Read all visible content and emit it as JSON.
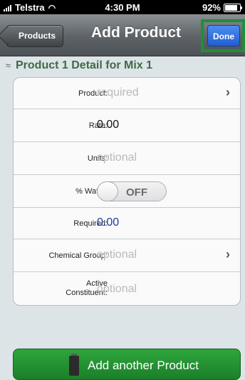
{
  "status_bar": {
    "carrier": "Telstra",
    "time": "4:30 PM",
    "battery_percent": "92%",
    "battery_level": 0.92
  },
  "nav": {
    "back_label": "Products",
    "title": "Add Product",
    "done_label": "Done",
    "done_highlight_color": "#1f8f3a"
  },
  "section": {
    "title": "Product 1 Detail for Mix 1",
    "collapse_icon": "collapse-up-icon"
  },
  "form": {
    "product": {
      "label": "Product:",
      "placeholder": "required"
    },
    "rate": {
      "label": "Rate:",
      "value": "0.00"
    },
    "units": {
      "label": "Units:",
      "placeholder": "optional"
    },
    "water": {
      "label": "% Water:",
      "toggle_state": "OFF"
    },
    "required": {
      "label": "Required:",
      "value": "0.00"
    },
    "chemical_group": {
      "label": "Chemical Group:",
      "placeholder": "optional"
    },
    "active_constituent": {
      "label_line1": "Active",
      "label_line2": "Constituent:",
      "placeholder": "optional"
    }
  },
  "add_button": {
    "label": "Add another Product",
    "icon": "chemical-can-icon",
    "color": "#2ea53c"
  }
}
